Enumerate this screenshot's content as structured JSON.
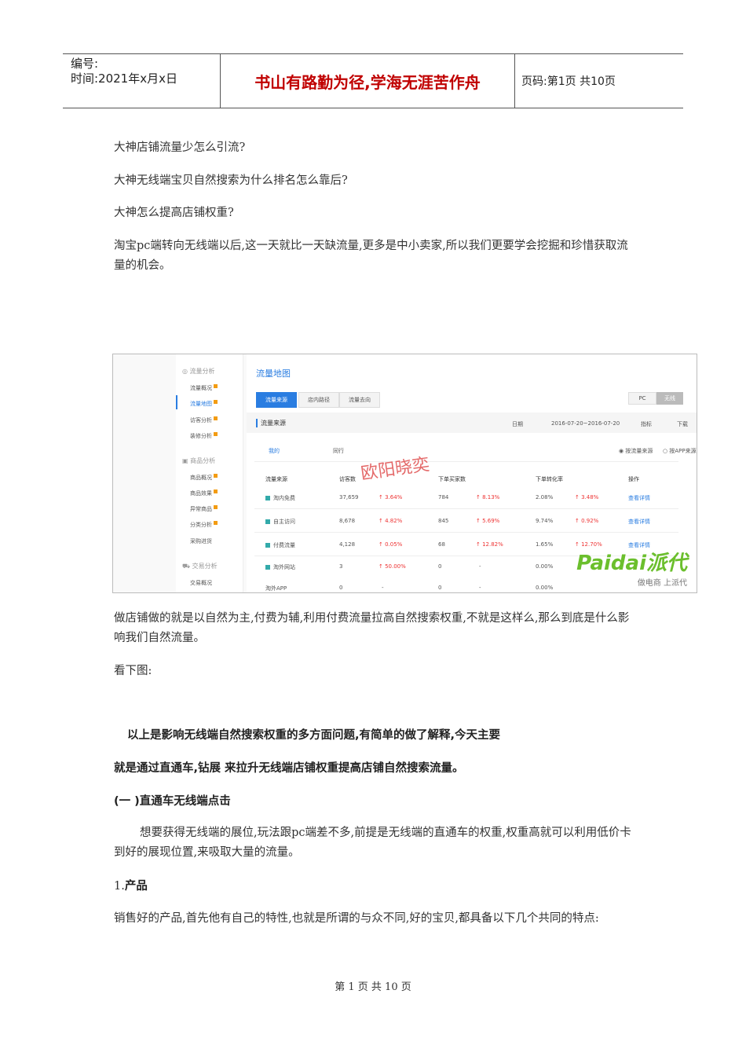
{
  "header": {
    "number_label": "编号:",
    "time_label": "时间:2021年x月x日",
    "slogan": "书山有路勤为径,学海无涯苦作舟",
    "page_info": "页码:第1页  共10页"
  },
  "paragraphs": {
    "q1": "大神店铺流量少怎么引流?",
    "q2": "大神无线端宝贝自然搜索为什么排名怎么靠后?",
    "q3": "大神怎么提高店铺权重?",
    "p1": "淘宝pc端转向无线端以后,这一天就比一天缺流量,更多是中小卖家,所以我们更要学会挖掘和珍惜获取流量的机会。",
    "p2": "做店铺做的就是以自然为主,付费为辅,利用付费流量拉高自然搜索权重,不就是这样么,那么到底是什么影响我们自然流量。",
    "p3": "看下图:",
    "b1": "以上是影响无线端自然搜索权重的多方面问题,有简单的做了解释,今天主要",
    "b2": "就是通过直通车,钻展 来拉升无线端店铺权重提高店铺自然搜索流量。",
    "h1": "(一 )直通车无线端点击",
    "p4": "想要获得无线端的展位,玩法跟pc端差不多,前提是无线端的直通车的权重,权重高就可以利用低价卡到好的展现位置,来吸取大量的流量。",
    "h2_num": "1.",
    "h2": "产品",
    "p5": "销售好的产品,首先他有自己的特性,也就是所谓的与众不同,好的宝贝,都具备以下几个共同的特点:"
  },
  "screenshot": {
    "sidebar": {
      "group1": "流量分析",
      "items1": [
        "流量概况",
        "流量地图",
        "访客分析",
        "装修分析"
      ],
      "group2": "商品分析",
      "items2": [
        "商品概况",
        "商品效果",
        "异常商品",
        "分类分析",
        "采购进货"
      ],
      "group3": "交易分析",
      "items3": [
        "交易概况"
      ]
    },
    "title": "流量地图",
    "tabs": [
      "流量来源",
      "店内路径",
      "流量去向"
    ],
    "toggle": [
      "PC",
      "无线"
    ],
    "section_title": "流量来源",
    "date_label": "日期",
    "date_range": "2016-07-20~2016-07-20",
    "metric_label": "指标",
    "download_label": "下载",
    "subtabs": [
      "我的",
      "同行"
    ],
    "radio1": "按流量来源",
    "radio2": "按APP来源",
    "columns": [
      "流量来源",
      "访客数",
      "下单买家数",
      "下单转化率",
      "操作"
    ],
    "rows": [
      {
        "name": "淘内免费",
        "visitors": "37,659",
        "v_change": "3.64%",
        "buyers": "784",
        "b_change": "8.13%",
        "rate": "2.08%",
        "r_change": "3.48%",
        "action": "查看详情"
      },
      {
        "name": "自主访问",
        "visitors": "8,678",
        "v_change": "4.82%",
        "buyers": "845",
        "b_change": "5.69%",
        "rate": "9.74%",
        "r_change": "0.92%",
        "action": "查看详情"
      },
      {
        "name": "付费流量",
        "visitors": "4,128",
        "v_change": "0.05%",
        "buyers": "68",
        "b_change": "12.82%",
        "rate": "1.65%",
        "r_change": "12.70%",
        "action": "查看详情"
      },
      {
        "name": "淘外网站",
        "visitors": "3",
        "v_change": "50.00%",
        "buyers": "0",
        "b_change": "-",
        "rate": "0.00%",
        "r_change": "",
        "action": ""
      },
      {
        "name": "淘外APP",
        "visitors": "0",
        "v_change": "-",
        "buyers": "0",
        "b_change": "-",
        "rate": "0.00%",
        "r_change": "",
        "action": ""
      }
    ],
    "watermark": "欧阳晓奕",
    "logo_main": "Paidai派代",
    "logo_sub": "做电商 上派代"
  },
  "footer": "第 1 页 共 10 页"
}
